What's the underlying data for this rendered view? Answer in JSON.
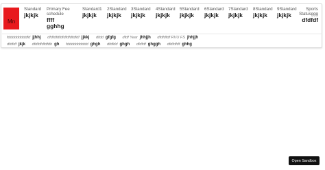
{
  "logo": {
    "text": "Mn"
  },
  "header": {
    "standard": {
      "label": "Standard",
      "value": "jkjkjk"
    },
    "primary_fee": {
      "label": "Primary Fee schedule",
      "value1": "ffff",
      "value2": "gghhg"
    },
    "standards": [
      {
        "label": "Standard1",
        "value": "jkjkjk"
      },
      {
        "label": "2Standard",
        "value": "jkjkjk"
      },
      {
        "label": "3Standard",
        "value": "jkjkjk"
      },
      {
        "label": "4Standard",
        "value": "jkjkjk"
      },
      {
        "label": "5Standard",
        "value": "jkjkjk"
      },
      {
        "label": "6Standard",
        "value": "jkjkjk"
      },
      {
        "label": "7Standard",
        "value": "jkjkjk"
      },
      {
        "label": "8Standard",
        "value": "jkjkjk"
      },
      {
        "label": "9Standard",
        "value": "jkjkjk"
      }
    ],
    "sports": {
      "label1": "Sports",
      "label2": "Statusggg",
      "value": "dfdfdf"
    }
  },
  "details_row1": [
    {
      "key": "fdddddddddfd",
      "value": "jjhhj"
    },
    {
      "key": "dfdfdfdfdfdfdfdfdfdf",
      "value": "jjkkj"
    },
    {
      "key": "dfdd",
      "value": "gfgfg"
    },
    {
      "key": "dfdf Year",
      "value": "jhhjjh"
    },
    {
      "key": "dfdfdfdf RVU FS",
      "value": "jhhjjh"
    }
  ],
  "details_row2": [
    {
      "key": "dfdfdf",
      "value": "jkjk"
    },
    {
      "key": "dfdfdfdfdfdh",
      "value": "gh"
    },
    {
      "key": "fdddddddddd",
      "value": "ghgh"
    },
    {
      "key": "dfdfdd",
      "value": "ghgh"
    },
    {
      "key": "dfdfdf",
      "value": "ghggh"
    },
    {
      "key": "dfdfdfdf",
      "value": "ghhg"
    }
  ],
  "sandbox_button": {
    "label": "Open Sandbox"
  },
  "colors": {
    "logo_bg": "#e8191d",
    "button_bg": "#111111"
  }
}
